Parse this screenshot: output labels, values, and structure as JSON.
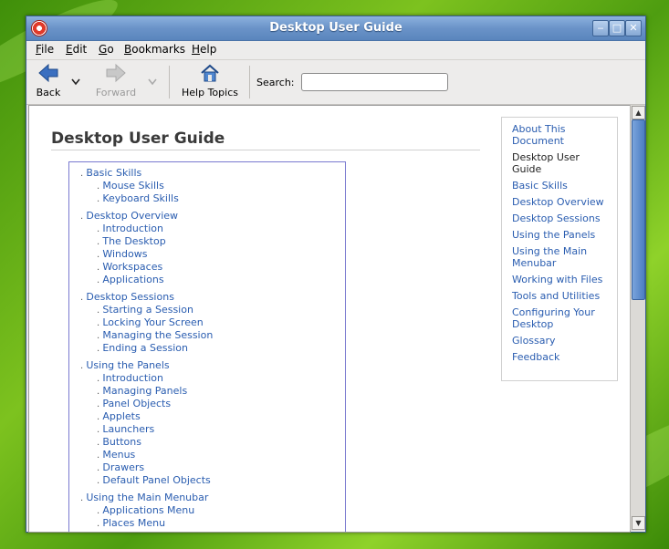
{
  "window": {
    "title": "Desktop User Guide",
    "controls": {
      "minimize": "‒",
      "maximize": "□",
      "close": "✕"
    }
  },
  "menubar": {
    "items": [
      {
        "label": "File",
        "accel": "F",
        "rest": "ile"
      },
      {
        "label": "Edit",
        "accel": "E",
        "rest": "dit"
      },
      {
        "label": "Go",
        "accel": "G",
        "rest": "o"
      },
      {
        "label": "Bookmarks",
        "accel": "B",
        "rest": "ookmarks"
      },
      {
        "label": "Help",
        "accel": "H",
        "rest": "elp"
      }
    ]
  },
  "toolbar": {
    "back_label": "Back",
    "forward_label": "Forward",
    "help_topics_label": "Help Topics",
    "search_label": "Search:",
    "search_value": ""
  },
  "page": {
    "title": "Desktop User Guide"
  },
  "toc": [
    {
      "label": "Basic Skills",
      "children": [
        "Mouse Skills",
        "Keyboard Skills"
      ]
    },
    {
      "label": "Desktop Overview",
      "children": [
        "Introduction",
        "The Desktop",
        "Windows",
        "Workspaces",
        "Applications"
      ]
    },
    {
      "label": "Desktop Sessions",
      "children": [
        "Starting a Session",
        "Locking Your Screen",
        "Managing the Session",
        "Ending a Session"
      ]
    },
    {
      "label": "Using the Panels",
      "children": [
        "Introduction",
        "Managing Panels",
        "Panel Objects",
        "Applets",
        "Launchers",
        "Buttons",
        "Menus",
        "Drawers",
        "Default Panel Objects"
      ]
    },
    {
      "label": "Using the Main Menubar",
      "children": [
        "Applications Menu",
        "Places Menu"
      ]
    }
  ],
  "sidebar": {
    "items": [
      {
        "lines": [
          "About This",
          "Document"
        ],
        "current": false
      },
      {
        "lines": [
          "Desktop User",
          "Guide"
        ],
        "current": true
      },
      {
        "lines": [
          "Basic Skills"
        ],
        "current": false
      },
      {
        "lines": [
          "Desktop Overview"
        ],
        "current": false
      },
      {
        "lines": [
          "Desktop Sessions"
        ],
        "current": false
      },
      {
        "lines": [
          "Using the Panels"
        ],
        "current": false
      },
      {
        "lines": [
          "Using the Main",
          "Menubar"
        ],
        "current": false
      },
      {
        "lines": [
          "Working with Files"
        ],
        "current": false
      },
      {
        "lines": [
          "Tools and Utilities"
        ],
        "current": false
      },
      {
        "lines": [
          "Configuring Your",
          "Desktop"
        ],
        "current": false
      },
      {
        "lines": [
          "Glossary"
        ],
        "current": false
      },
      {
        "lines": [
          "Feedback"
        ],
        "current": false
      }
    ]
  },
  "colors": {
    "link": "#2a5db0",
    "titlebar": "#6a93c8",
    "scroll_thumb": "#4c7dc2"
  }
}
